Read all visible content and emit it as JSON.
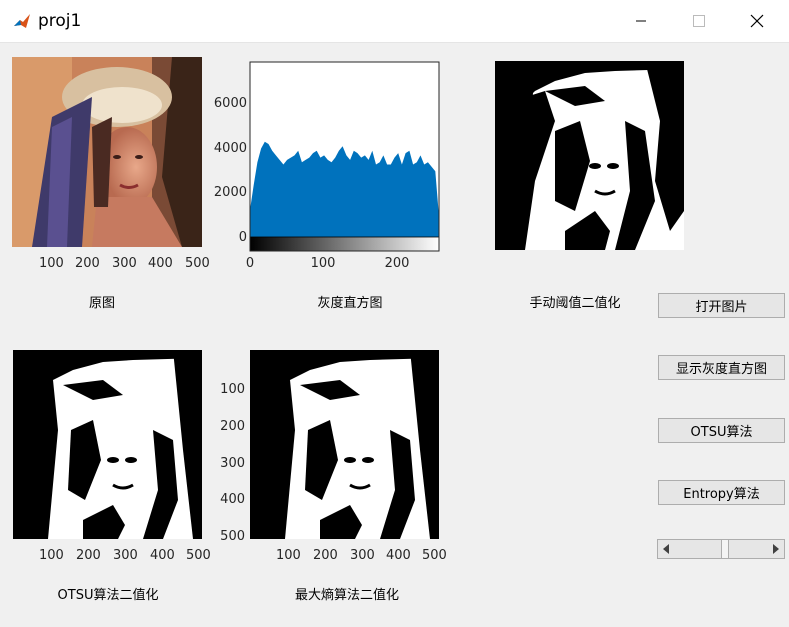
{
  "window": {
    "title": "proj1"
  },
  "axes_original": {
    "xticks": [
      "100",
      "200",
      "300",
      "400",
      "500"
    ],
    "caption": "原图"
  },
  "histogram": {
    "caption": "灰度直方图",
    "xticks": [
      "0",
      "100",
      "200"
    ],
    "yticks": [
      "6000",
      "4000",
      "2000",
      "0"
    ]
  },
  "axes_manual": {
    "caption": "手动阈值二值化"
  },
  "axes_otsu": {
    "xticks": [
      "100",
      "200",
      "300",
      "400",
      "500"
    ],
    "caption": "OTSU算法二值化"
  },
  "axes_entropy": {
    "xticks": [
      "100",
      "200",
      "300",
      "400",
      "500"
    ],
    "yticks": [
      "100",
      "200",
      "300",
      "400",
      "500"
    ],
    "caption": "最大熵算法二值化"
  },
  "buttons": {
    "open_image": "打开图片",
    "show_histogram": "显示灰度直方图",
    "otsu": "OTSU算法",
    "entropy": "Entropy算法"
  },
  "slider": {
    "value_fraction": 0.55
  },
  "colors": {
    "histogram_fill": "#0072bd",
    "background": "#f0f0f0"
  },
  "chart_data": {
    "type": "area",
    "xlabel": "",
    "ylabel": "",
    "xlim": [
      0,
      255
    ],
    "ylim": [
      -500,
      7800
    ],
    "x": [
      0,
      5,
      10,
      15,
      20,
      25,
      30,
      35,
      40,
      45,
      50,
      55,
      60,
      65,
      70,
      75,
      80,
      85,
      90,
      95,
      100,
      105,
      110,
      115,
      120,
      125,
      130,
      135,
      140,
      145,
      150,
      155,
      160,
      165,
      170,
      175,
      180,
      185,
      190,
      195,
      200,
      205,
      210,
      215,
      220,
      225,
      230,
      235,
      240,
      245,
      250,
      255
    ],
    "values": [
      1300,
      2400,
      3400,
      4000,
      4300,
      4200,
      3900,
      3700,
      3500,
      3300,
      3500,
      3600,
      3700,
      3900,
      3400,
      3500,
      3600,
      3800,
      3900,
      3600,
      3700,
      3500,
      3400,
      3600,
      3900,
      4100,
      3700,
      3500,
      3900,
      3800,
      3600,
      3700,
      3500,
      3900,
      3300,
      3400,
      3700,
      3300,
      3300,
      3600,
      3800,
      3300,
      3800,
      3900,
      3300,
      3400,
      3700,
      3300,
      3400,
      3200,
      3000,
      1000
    ]
  }
}
